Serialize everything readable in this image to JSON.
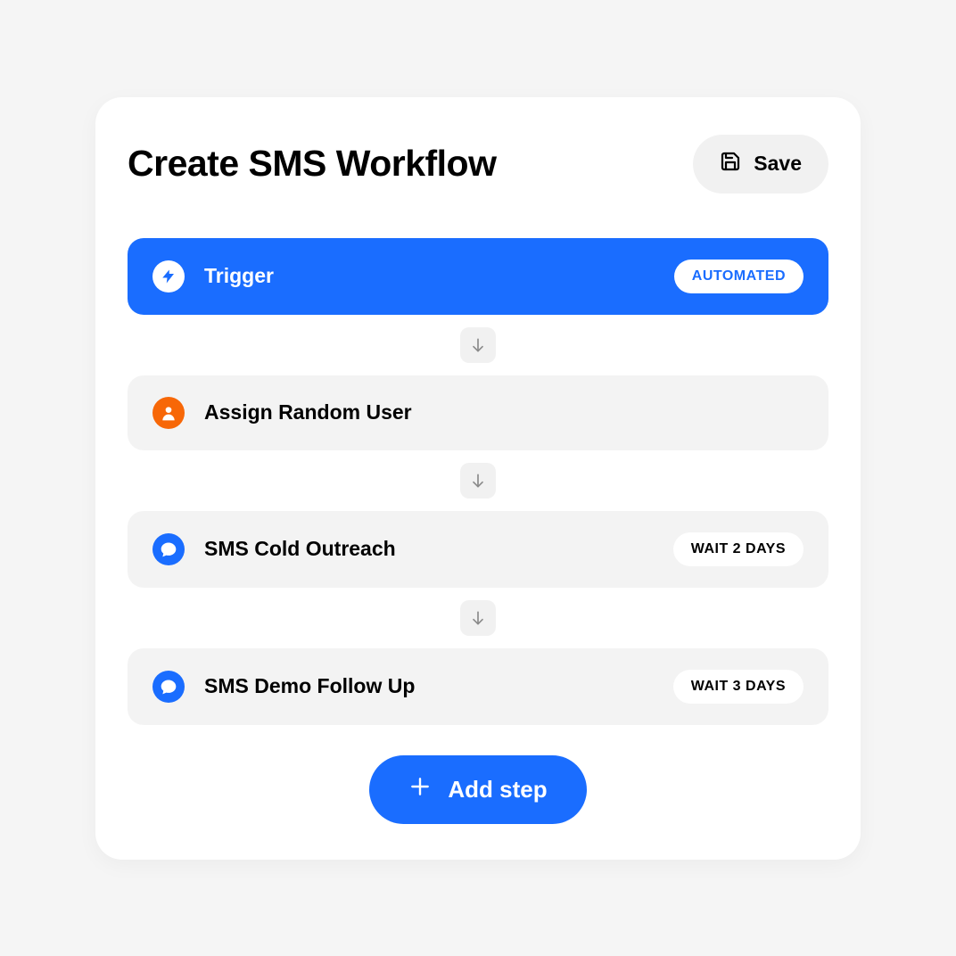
{
  "header": {
    "title": "Create SMS Workflow",
    "save_label": "Save"
  },
  "steps": {
    "trigger": {
      "label": "Trigger",
      "badge": "AUTOMATED"
    },
    "assign": {
      "label": "Assign Random User"
    },
    "cold": {
      "label": "SMS Cold Outreach",
      "badge": "WAIT 2 DAYS"
    },
    "follow": {
      "label": "SMS Demo Follow Up",
      "badge": "WAIT 3 DAYS"
    }
  },
  "add_step_label": "Add step",
  "colors": {
    "primary": "#1a6dff",
    "orange": "#f76707"
  }
}
